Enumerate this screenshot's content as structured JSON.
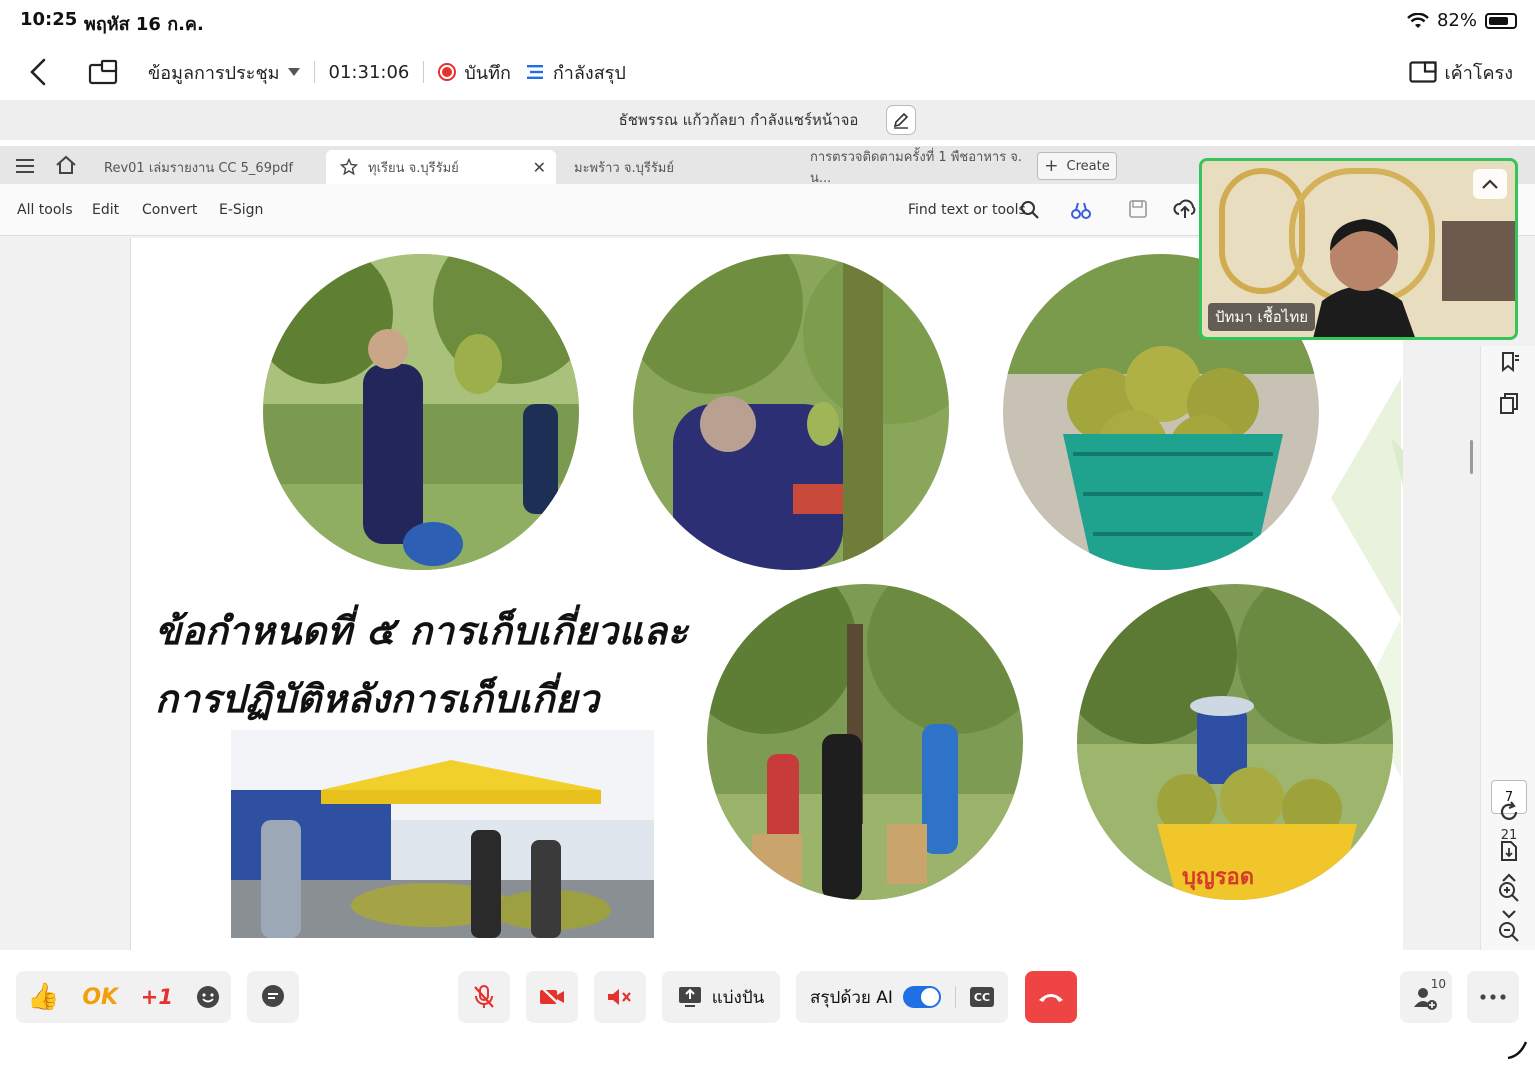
{
  "status_bar": {
    "time": "10:25",
    "date": "พฤหัส 16 ก.ค.",
    "battery": "82%",
    "battery_level": 0.82
  },
  "meeting_header": {
    "info_label": "ข้อมูลการประชุม",
    "duration": "01:31:06",
    "record_label": "บันทึก",
    "summary_label": "กำลังสรุป",
    "layout_label": "เค้าโครง"
  },
  "share_banner": {
    "text": "ธัชพรรณ แก้วกัลยา กำลังแชร์หน้าจอ"
  },
  "pdf_app": {
    "tabs": [
      {
        "label": "Rev01 เล่มรายงาน CC 5_69pdf"
      },
      {
        "label": "ทุเรียน จ.บุรีรัมย์"
      },
      {
        "label": "มะพร้าว จ.บุรีรัมย์"
      },
      {
        "label": "การตรวจติดตามครั้งที่ 1 พืชอาหาร จ. น..."
      }
    ],
    "create_label": "Create",
    "menu": {
      "all_tools": "All tools",
      "edit": "Edit",
      "convert": "Convert",
      "esign": "E-Sign"
    },
    "search_label": "Find text or tools",
    "page_current": "7",
    "page_total": "21"
  },
  "slide": {
    "heading_line1": "ข้อกำหนดที่ ๕ การเก็บเกี่ยวและ",
    "heading_line2": "การปฏิบัติหลังการเก็บเกี่ยว",
    "basket_label": "บุญรอด"
  },
  "video_tile": {
    "participant_name": "ปัทมา เชื้อไทย"
  },
  "bottom_bar": {
    "reaction_ok": "OK",
    "reaction_plus": "+1",
    "share_label": "แบ่งปัน",
    "ai_summary_label": "สรุปด้วย AI",
    "cc_label": "CC",
    "participant_count": "10"
  },
  "colors": {
    "accent": "#1f6fe5",
    "record": "#e5322d",
    "end_call": "#ef4444",
    "active_speaker": "#35c45a"
  }
}
